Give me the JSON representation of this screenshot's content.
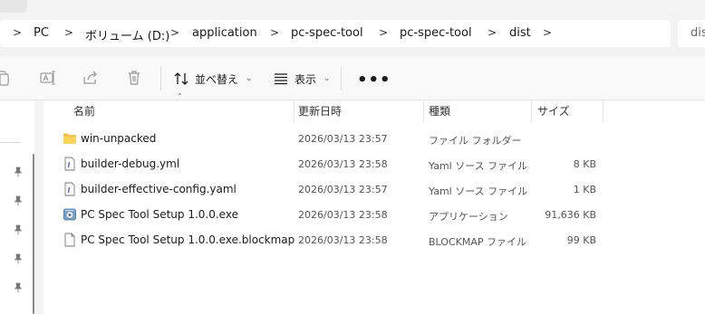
{
  "breadcrumb": {
    "segments": [
      "PC",
      "ボリューム (D:)",
      "application",
      "pc-spec-tool",
      "pc-spec-tool",
      "dist"
    ],
    "separator": ">"
  },
  "search": {
    "partial_text": "dis"
  },
  "toolbar": {
    "sort_label": "並べ替え",
    "view_label": "表示",
    "more_label": "•••"
  },
  "columns": {
    "name": "名前",
    "modified": "更新日時",
    "type": "種類",
    "size": "サイズ"
  },
  "files": [
    {
      "name": "win-unpacked",
      "modified": "2026/03/13 23:57",
      "type": "ファイル フォルダー",
      "size": "",
      "icon": "folder-icon"
    },
    {
      "name": "builder-debug.yml",
      "modified": "2026/03/13 23:58",
      "type": "Yaml ソース ファイル",
      "size": "8 KB",
      "icon": "yaml-file-icon"
    },
    {
      "name": "builder-effective-config.yaml",
      "modified": "2026/03/13 23:57",
      "type": "Yaml ソース ファイル",
      "size": "1 KB",
      "icon": "yaml-file-icon"
    },
    {
      "name": "PC Spec Tool Setup 1.0.0.exe",
      "modified": "2026/03/13 23:58",
      "type": "アプリケーション",
      "size": "91,636 KB",
      "icon": "installer-exe-icon"
    },
    {
      "name": "PC Spec Tool Setup 1.0.0.exe.blockmap",
      "modified": "2026/03/13 23:58",
      "type": "BLOCKMAP ファイル",
      "size": "99 KB",
      "icon": "generic-file-icon"
    }
  ],
  "colors": {
    "accent": "#0067c0",
    "folder": "#f4c04f"
  }
}
